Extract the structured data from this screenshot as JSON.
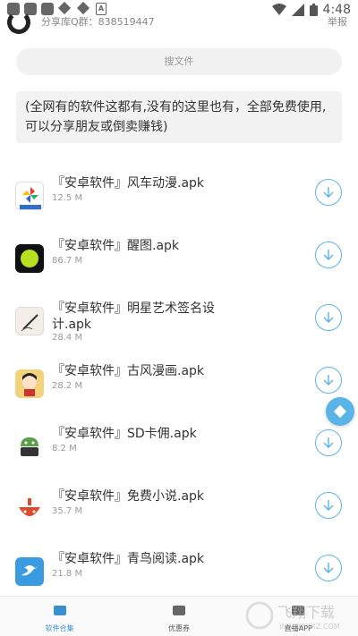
{
  "status_bar": {
    "time": "4:48"
  },
  "header": {
    "text": "分享库Q群：838519447",
    "right": "举报"
  },
  "search": {
    "placeholder": "搜文件"
  },
  "notice": "(全网有的软件这都有,没有的这里也有，全部免费使用,可以分享朋友或倒卖赚钱)",
  "items": [
    {
      "title": "『安卓软件』风车动漫.apk",
      "size": "12.5 M",
      "icon": "windmill-icon",
      "color": "#2f6fc8"
    },
    {
      "title": "『安卓软件』醒图.apk",
      "size": "86.7 M",
      "icon": "xingtu-icon",
      "color": "#111111"
    },
    {
      "title": "『安卓软件』明星艺术签名设计.apk",
      "size": "28.4 M",
      "icon": "signature-icon",
      "color": "#e8e2d6"
    },
    {
      "title": "『安卓软件』古风漫画.apk",
      "size": "28.2 M",
      "icon": "comic-icon",
      "color": "#f2d27a"
    },
    {
      "title": "『安卓软件』SD卡佣.apk",
      "size": "8.2 M",
      "icon": "android-icon",
      "color": "#5aa04a"
    },
    {
      "title": "『安卓软件』免费小说.apk",
      "size": "35.7 M",
      "icon": "novel-icon",
      "color": "#e04a2c"
    },
    {
      "title": "『安卓软件』青鸟阅读.apk",
      "size": "21.8 M",
      "icon": "bird-icon",
      "color": "#3a9be0"
    }
  ],
  "nav": [
    {
      "label": "软件合集",
      "active": true
    },
    {
      "label": "优惠券",
      "active": false
    },
    {
      "label": "直播APP",
      "active": false
    }
  ],
  "watermark": "飞翔下载",
  "watermark_url": "WWW.FXXZ.COM"
}
